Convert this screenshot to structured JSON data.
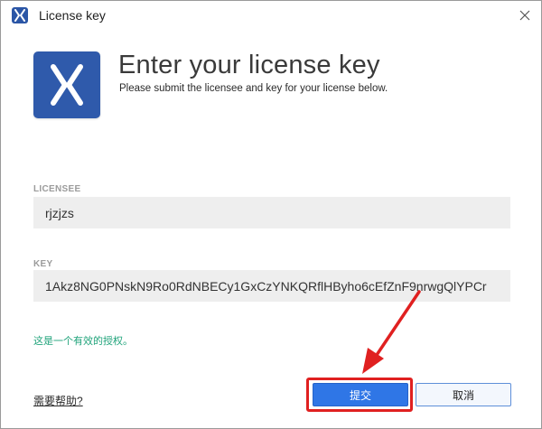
{
  "window": {
    "title": "License key",
    "app_icon": "xshell-x-icon",
    "close_icon": "close-icon"
  },
  "header": {
    "logo": "xshell-logo",
    "heading": "Enter your license key",
    "subheading": "Please submit the licensee and key for your license below."
  },
  "licensee": {
    "label": "LICENSEE",
    "value": "rjzjzs"
  },
  "key": {
    "label": "KEY",
    "value": "1Akz8NG0PNskN9Ro0RdNBECy1GxCzYNKQRflHByho6cEfZnF9nrwgQlYPCr"
  },
  "status": {
    "message": "这是一个有效的授权。",
    "color": "#1fa37a"
  },
  "footer": {
    "help_link": "需要帮助?",
    "submit_label": "提交",
    "cancel_label": "取消"
  },
  "colors": {
    "accent": "#2f76e6",
    "brand": "#2f5aab",
    "annotation": "#e02020"
  }
}
